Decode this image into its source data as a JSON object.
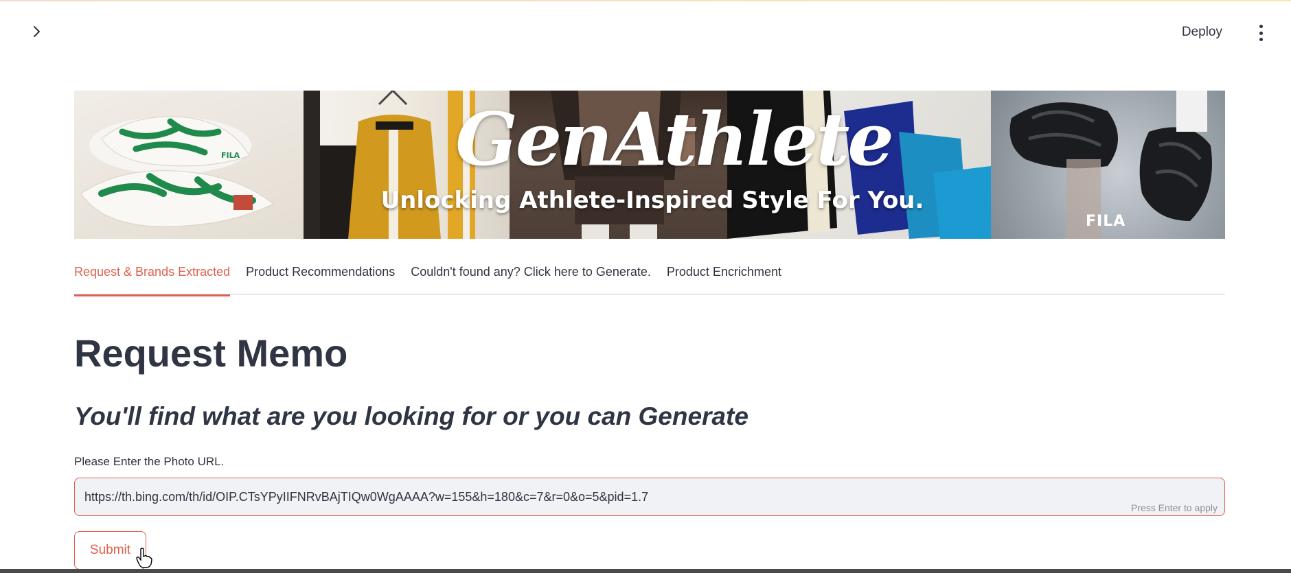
{
  "header": {
    "deploy_label": "Deploy",
    "icons": [
      "chevron-right-icon",
      "kebab-menu-icon"
    ]
  },
  "banner": {
    "title": "GenAthlete",
    "subtitle": "Unlocking Athlete-Inspired Style For You.",
    "logo_text": "FILA"
  },
  "tabs": [
    {
      "label": "Request & Brands Extracted",
      "active": true
    },
    {
      "label": "Product Recommendations",
      "active": false
    },
    {
      "label": "Couldn't found any? Click here to Generate.",
      "active": false
    },
    {
      "label": "Product Encrichment",
      "active": false
    }
  ],
  "main": {
    "title": "Request Memo",
    "subtitle": "You'll find what are you looking for or you can Generate",
    "url_field": {
      "label": "Please Enter the Photo URL.",
      "value": "https://th.bing.com/th/id/OIP.CTsYPyIIFNRvBAjTIQw0WgAAAA?w=155&h=180&c=7&r=0&o=5&pid=1.7",
      "hint": "Press Enter to apply"
    },
    "submit_label": "Submit"
  },
  "colors": {
    "accent": "#e0604d",
    "text": "#31333f",
    "input_bg": "#f0f2f6"
  }
}
